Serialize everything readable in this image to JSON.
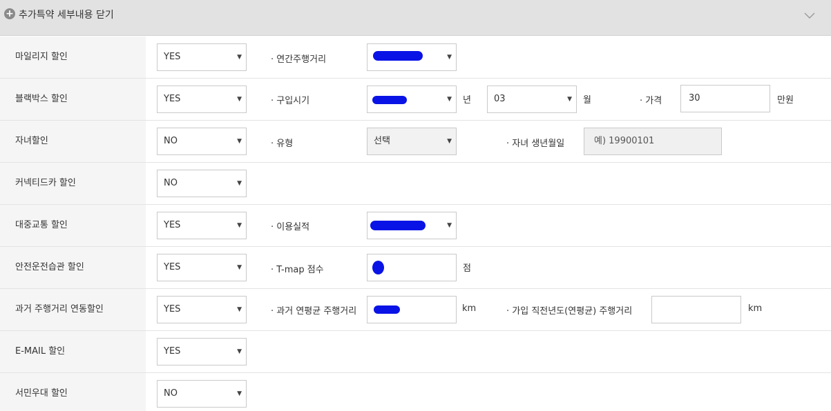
{
  "header": {
    "icon": "plus-circle-icon",
    "title": "추가특약 세부내용 닫기",
    "toggle_icon": "chevron-down-icon"
  },
  "rows": [
    {
      "label": "마일리지 할인",
      "value": "YES",
      "sub1": "· 연간주행거리"
    },
    {
      "label": "블랙박스 할인",
      "value": "YES",
      "sub1": "· 구입시기",
      "unit_year": "년",
      "month_value": "03",
      "unit_month": "월",
      "sub2": "· 가격",
      "price_value": "30",
      "unit_price": "만원"
    },
    {
      "label": "자녀할인",
      "value": "NO",
      "sub1": "· 유형",
      "type_value": "선택",
      "sub2": "· 자녀 생년월일",
      "birth_placeholder": "예) 19900101"
    },
    {
      "label": "커넥티드카 할인",
      "value": "NO"
    },
    {
      "label": "대중교통 할인",
      "value": "YES",
      "sub1": "· 이용실적"
    },
    {
      "label": "안전운전습관 할인",
      "value": "YES",
      "sub1": "· T-map 점수",
      "unit": "점"
    },
    {
      "label": "과거 주행거리 연동할인",
      "value": "YES",
      "sub1": "· 과거 연평균 주행거리",
      "unit1": "km",
      "sub2": "· 가입 직전년도(연평균) 주행거리",
      "unit2": "km"
    },
    {
      "label": "E-MAIL 할인",
      "value": "YES"
    },
    {
      "label": "서민우대 할인",
      "value": "NO"
    }
  ],
  "colors": {
    "header_bg": "#e2e2e2",
    "label_bg": "#f5f5f5",
    "redaction": "#0a13e6"
  }
}
